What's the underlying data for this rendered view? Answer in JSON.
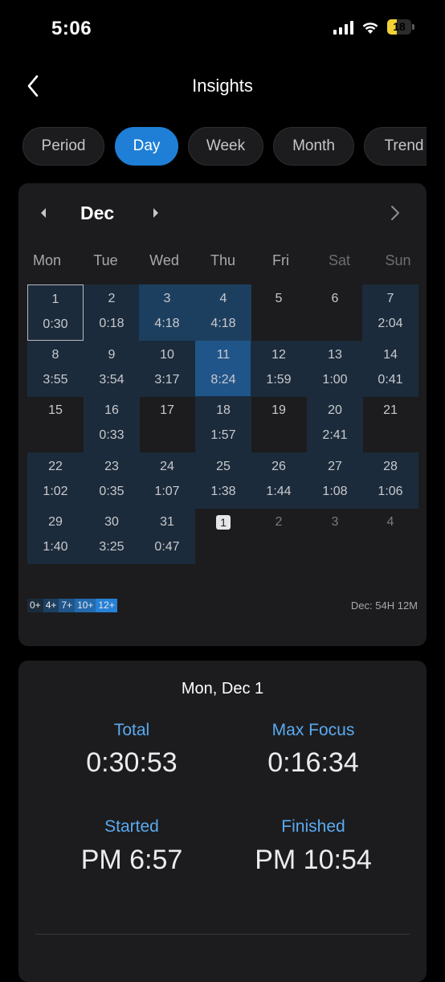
{
  "status_bar": {
    "time": "5:06",
    "battery": "18"
  },
  "header": {
    "title": "Insights"
  },
  "tabs": [
    {
      "label": "Period",
      "active": false
    },
    {
      "label": "Day",
      "active": true
    },
    {
      "label": "Week",
      "active": false
    },
    {
      "label": "Month",
      "active": false
    },
    {
      "label": "Trend",
      "active": false
    }
  ],
  "calendar": {
    "month": "Dec",
    "weekdays": [
      "Mon",
      "Tue",
      "Wed",
      "Thu",
      "Fri",
      "Sat",
      "Sun"
    ],
    "cells": [
      {
        "day": "1",
        "time": "0:30",
        "level": 1,
        "selected": true
      },
      {
        "day": "2",
        "time": "0:18",
        "level": 1
      },
      {
        "day": "3",
        "time": "4:18",
        "level": 2
      },
      {
        "day": "4",
        "time": "4:18",
        "level": 2
      },
      {
        "day": "5",
        "time": "",
        "level": 0
      },
      {
        "day": "6",
        "time": "",
        "level": 0
      },
      {
        "day": "7",
        "time": "2:04",
        "level": 1
      },
      {
        "day": "8",
        "time": "3:55",
        "level": 1
      },
      {
        "day": "9",
        "time": "3:54",
        "level": 1
      },
      {
        "day": "10",
        "time": "3:17",
        "level": 1
      },
      {
        "day": "11",
        "time": "8:24",
        "level": 3
      },
      {
        "day": "12",
        "time": "1:59",
        "level": 1
      },
      {
        "day": "13",
        "time": "1:00",
        "level": 1
      },
      {
        "day": "14",
        "time": "0:41",
        "level": 1
      },
      {
        "day": "15",
        "time": "",
        "level": 0
      },
      {
        "day": "16",
        "time": "0:33",
        "level": 1
      },
      {
        "day": "17",
        "time": "",
        "level": 0
      },
      {
        "day": "18",
        "time": "1:57",
        "level": 1
      },
      {
        "day": "19",
        "time": "",
        "level": 0
      },
      {
        "day": "20",
        "time": "2:41",
        "level": 1
      },
      {
        "day": "21",
        "time": "",
        "level": 0
      },
      {
        "day": "22",
        "time": "1:02",
        "level": 1
      },
      {
        "day": "23",
        "time": "0:35",
        "level": 1
      },
      {
        "day": "24",
        "time": "1:07",
        "level": 1
      },
      {
        "day": "25",
        "time": "1:38",
        "level": 1
      },
      {
        "day": "26",
        "time": "1:44",
        "level": 1
      },
      {
        "day": "27",
        "time": "1:08",
        "level": 1
      },
      {
        "day": "28",
        "time": "1:06",
        "level": 1
      },
      {
        "day": "29",
        "time": "1:40",
        "level": 1
      },
      {
        "day": "30",
        "time": "3:25",
        "level": 1
      },
      {
        "day": "31",
        "time": "0:47",
        "level": 1
      },
      {
        "day": "1",
        "time": "",
        "level": -1,
        "today": true
      },
      {
        "day": "2",
        "time": "",
        "level": -1
      },
      {
        "day": "3",
        "time": "",
        "level": -1
      },
      {
        "day": "4",
        "time": "",
        "level": -1
      }
    ],
    "legend": [
      {
        "label": "0+",
        "color": "#1b2b3b"
      },
      {
        "label": "4+",
        "color": "#1d3f5f"
      },
      {
        "label": "7+",
        "color": "#20558a"
      },
      {
        "label": "10+",
        "color": "#236aae"
      },
      {
        "label": "12+",
        "color": "#2681d6"
      }
    ],
    "month_total": "Dec: 54H 12M"
  },
  "details": {
    "date": "Mon, Dec 1",
    "total_label": "Total",
    "total_value": "0:30:53",
    "max_focus_label": "Max Focus",
    "max_focus_value": "0:16:34",
    "started_label": "Started",
    "started_value": "PM 6:57",
    "finished_label": "Finished",
    "finished_value": "PM 10:54"
  }
}
